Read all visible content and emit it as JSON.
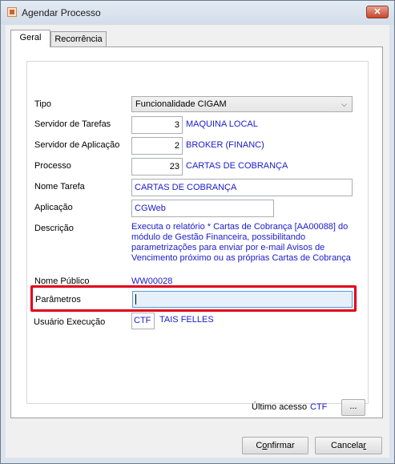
{
  "window": {
    "title": "Agendar Processo",
    "close_label": "✕"
  },
  "tabs": [
    {
      "label": "Geral",
      "active": true
    },
    {
      "label": "Recorrência",
      "active": false
    }
  ],
  "form": {
    "tipo": {
      "label": "Tipo",
      "value": "Funcionalidade CIGAM"
    },
    "servidor_tarefas": {
      "label": "Servidor de Tarefas",
      "code": "3",
      "name": "MAQUINA LOCAL"
    },
    "servidor_aplicacao": {
      "label": "Servidor de Aplicação",
      "code": "2",
      "name": "BROKER (FINANC)"
    },
    "processo": {
      "label": "Processo",
      "code": "23",
      "name": "CARTAS DE COBRANÇA"
    },
    "nome_tarefa": {
      "label": "Nome Tarefa",
      "value": "CARTAS DE COBRANÇA"
    },
    "aplicacao": {
      "label": "Aplicação",
      "value": "CGWeb"
    },
    "descricao": {
      "label": "Descrição",
      "value": "Executa o relatório * Cartas de Cobrança [AA00088] do módulo de Gestão Financeira, possibilitando parametrizações para enviar por e-mail Avisos de Vencimento próximo ou as próprias Cartas de Cobrança"
    },
    "nome_publico": {
      "label": "Nome Público",
      "value": "WW00028"
    },
    "parametros": {
      "label": "Parâmetros",
      "value": ""
    },
    "usuario_execucao": {
      "label": "Usuário Execução",
      "code": "CTF",
      "name": "TAIS FELLES"
    },
    "ultimo_acesso": {
      "label": "Último acesso",
      "value": "CTF",
      "button_label": "..."
    }
  },
  "buttons": {
    "confirmar_pre": "C",
    "confirmar_underline": "o",
    "confirmar_post": "nfirmar",
    "cancelar_pre": "Cancela",
    "cancelar_underline": "r",
    "cancelar_post": ""
  },
  "colors": {
    "value_text": "#1a1acc",
    "highlight_border": "#e0001b",
    "focused_input_bg": "#e6f0fa"
  }
}
